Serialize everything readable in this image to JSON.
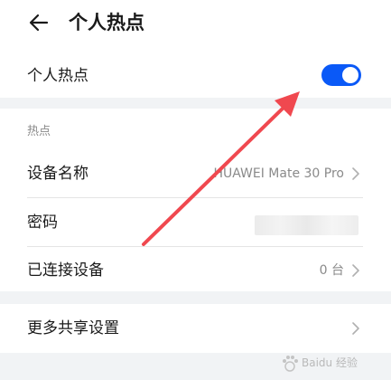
{
  "header": {
    "title": "个人热点",
    "back_icon": "arrow-left-icon"
  },
  "hotspot_toggle": {
    "label": "个人热点",
    "enabled": true,
    "color": "#0a59f7"
  },
  "hotspot_section": {
    "title": "热点",
    "device_name": {
      "label": "设备名称",
      "value": "HUAWEI Mate 30 Pro"
    },
    "password": {
      "label": "密码"
    },
    "connected_devices": {
      "label": "已连接设备",
      "value": "0 台"
    }
  },
  "more_sharing": {
    "label": "更多共享设置"
  },
  "annotation": {
    "color": "#f0484f"
  },
  "watermark": {
    "text": "Baidu 经验"
  }
}
